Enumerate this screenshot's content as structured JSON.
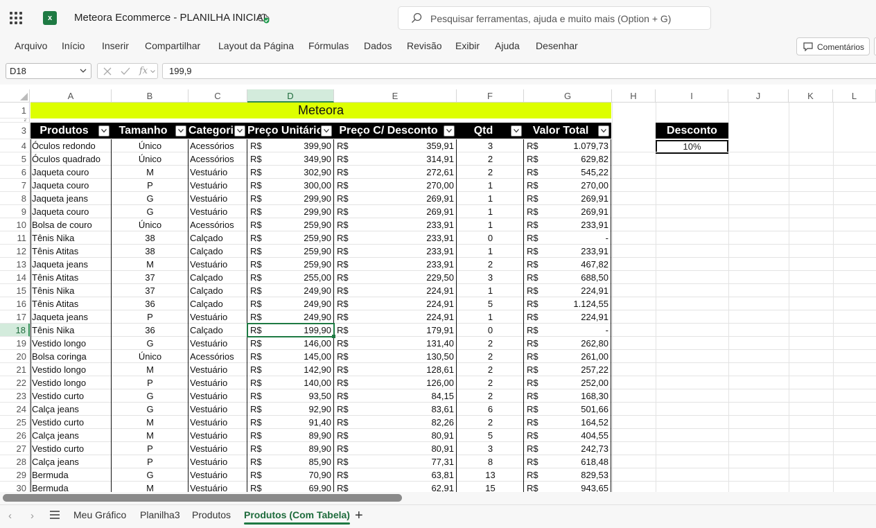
{
  "app": {
    "doc_title": "Meteora Ecommerce - PLANILHA INICIAL",
    "logo_text": "x",
    "search_placeholder": "Pesquisar ferramentas, ajuda e muito mais (Option + G)"
  },
  "menu": [
    "Arquivo",
    "Início",
    "Inserir",
    "Compartilhar",
    "Layout da Página",
    "Fórmulas",
    "Dados",
    "Revisão",
    "Exibir",
    "Ajuda",
    "Desenhar"
  ],
  "comments_label": "Comentários",
  "formula_bar": {
    "name_box": "D18",
    "formula": "199,9",
    "fx_label": "fx"
  },
  "columns": [
    "A",
    "B",
    "C",
    "D",
    "E",
    "F",
    "G",
    "H",
    "I",
    "J",
    "K",
    "L"
  ],
  "selected_column": "D",
  "selected_row": "18",
  "title_row": {
    "row": "1",
    "text": "Meteora"
  },
  "hidden_row_marker": "2",
  "table_headers": [
    "Produtos",
    "Tamanho",
    "Categoria",
    "Preço Unitário",
    "Preço C/ Desconto",
    "Qtd",
    "Valor Total"
  ],
  "currency": "R$",
  "discount": {
    "label": "Desconto",
    "value": "10%"
  },
  "rows": [
    {
      "n": "4",
      "a": "Óculos redondo",
      "b": "Único",
      "c": "Acessórios",
      "d": "399,90",
      "e": "359,91",
      "f": "3",
      "g": "1.079,73"
    },
    {
      "n": "5",
      "a": "Óculos quadrado",
      "b": "Único",
      "c": "Acessórios",
      "d": "349,90",
      "e": "314,91",
      "f": "2",
      "g": "629,82"
    },
    {
      "n": "6",
      "a": "Jaqueta couro",
      "b": "M",
      "c": "Vestuário",
      "d": "302,90",
      "e": "272,61",
      "f": "2",
      "g": "545,22"
    },
    {
      "n": "7",
      "a": "Jaqueta couro",
      "b": "P",
      "c": "Vestuário",
      "d": "300,00",
      "e": "270,00",
      "f": "1",
      "g": "270,00"
    },
    {
      "n": "8",
      "a": "Jaqueta jeans",
      "b": "G",
      "c": "Vestuário",
      "d": "299,90",
      "e": "269,91",
      "f": "1",
      "g": "269,91"
    },
    {
      "n": "9",
      "a": "Jaqueta couro",
      "b": "G",
      "c": "Vestuário",
      "d": "299,90",
      "e": "269,91",
      "f": "1",
      "g": "269,91"
    },
    {
      "n": "10",
      "a": "Bolsa de couro",
      "b": "Único",
      "c": "Acessórios",
      "d": "259,90",
      "e": "233,91",
      "f": "1",
      "g": "233,91"
    },
    {
      "n": "11",
      "a": "Tênis Nika",
      "b": "38",
      "c": "Calçado",
      "d": "259,90",
      "e": "233,91",
      "f": "0",
      "g": "-"
    },
    {
      "n": "12",
      "a": "Tênis Atitas",
      "b": "38",
      "c": "Calçado",
      "d": "259,90",
      "e": "233,91",
      "f": "1",
      "g": "233,91"
    },
    {
      "n": "13",
      "a": "Jaqueta jeans",
      "b": "M",
      "c": "Vestuário",
      "d": "259,90",
      "e": "233,91",
      "f": "2",
      "g": "467,82"
    },
    {
      "n": "14",
      "a": "Tênis Atitas",
      "b": "37",
      "c": "Calçado",
      "d": "255,00",
      "e": "229,50",
      "f": "3",
      "g": "688,50"
    },
    {
      "n": "15",
      "a": "Tênis Nika",
      "b": "37",
      "c": "Calçado",
      "d": "249,90",
      "e": "224,91",
      "f": "1",
      "g": "224,91"
    },
    {
      "n": "16",
      "a": "Tênis Atitas",
      "b": "36",
      "c": "Calçado",
      "d": "249,90",
      "e": "224,91",
      "f": "5",
      "g": "1.124,55"
    },
    {
      "n": "17",
      "a": "Jaqueta jeans",
      "b": "P",
      "c": "Vestuário",
      "d": "249,90",
      "e": "224,91",
      "f": "1",
      "g": "224,91"
    },
    {
      "n": "18",
      "a": "Tênis Nika",
      "b": "36",
      "c": "Calçado",
      "d": "199,90",
      "e": "179,91",
      "f": "0",
      "g": "-"
    },
    {
      "n": "19",
      "a": "Vestido longo",
      "b": "G",
      "c": "Vestuário",
      "d": "146,00",
      "e": "131,40",
      "f": "2",
      "g": "262,80"
    },
    {
      "n": "20",
      "a": "Bolsa coringa",
      "b": "Único",
      "c": "Acessórios",
      "d": "145,00",
      "e": "130,50",
      "f": "2",
      "g": "261,00"
    },
    {
      "n": "21",
      "a": "Vestido longo",
      "b": "M",
      "c": "Vestuário",
      "d": "142,90",
      "e": "128,61",
      "f": "2",
      "g": "257,22"
    },
    {
      "n": "22",
      "a": "Vestido longo",
      "b": "P",
      "c": "Vestuário",
      "d": "140,00",
      "e": "126,00",
      "f": "2",
      "g": "252,00"
    },
    {
      "n": "23",
      "a": "Vestido curto",
      "b": "G",
      "c": "Vestuário",
      "d": "93,50",
      "e": "84,15",
      "f": "2",
      "g": "168,30"
    },
    {
      "n": "24",
      "a": "Calça jeans",
      "b": "G",
      "c": "Vestuário",
      "d": "92,90",
      "e": "83,61",
      "f": "6",
      "g": "501,66"
    },
    {
      "n": "25",
      "a": "Vestido curto",
      "b": "M",
      "c": "Vestuário",
      "d": "91,40",
      "e": "82,26",
      "f": "2",
      "g": "164,52"
    },
    {
      "n": "26",
      "a": "Calça jeans",
      "b": "M",
      "c": "Vestuário",
      "d": "89,90",
      "e": "80,91",
      "f": "5",
      "g": "404,55"
    },
    {
      "n": "27",
      "a": "Vestido curto",
      "b": "P",
      "c": "Vestuário",
      "d": "89,90",
      "e": "80,91",
      "f": "3",
      "g": "242,73"
    },
    {
      "n": "28",
      "a": "Calça jeans",
      "b": "P",
      "c": "Vestuário",
      "d": "85,90",
      "e": "77,31",
      "f": "8",
      "g": "618,48"
    },
    {
      "n": "29",
      "a": "Bermuda",
      "b": "G",
      "c": "Vestuário",
      "d": "70,90",
      "e": "63,81",
      "f": "13",
      "g": "829,53"
    },
    {
      "n": "30",
      "a": "Bermuda",
      "b": "M",
      "c": "Vestuário",
      "d": "69,90",
      "e": "62,91",
      "f": "15",
      "g": "943,65"
    }
  ],
  "sheet_tabs": [
    "Meu Gráfico",
    "Planilha3",
    "Produtos",
    "Produtos (Com Tabela)"
  ],
  "active_sheet": "Produtos (Com Tabela)",
  "colors": {
    "accent": "#1e7a43",
    "title_band": "#ddff00",
    "header_band": "#000000"
  }
}
